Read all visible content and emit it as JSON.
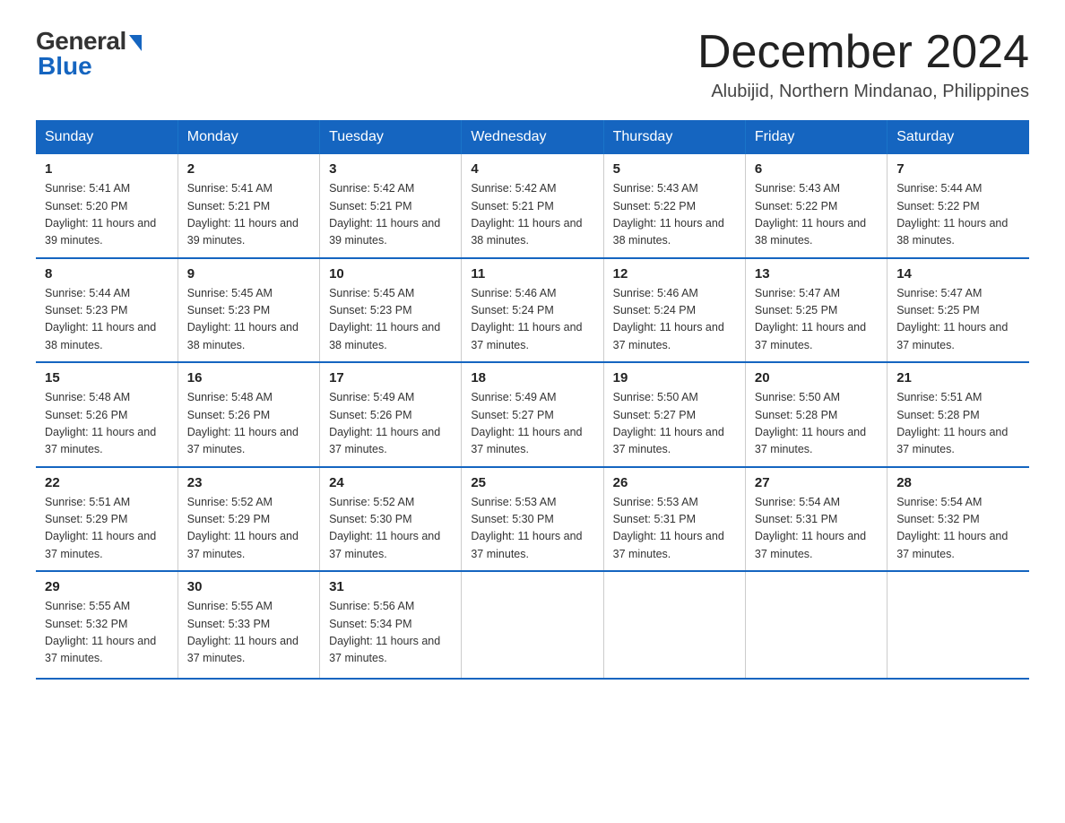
{
  "header": {
    "logo_general": "General",
    "logo_blue": "Blue",
    "month_title": "December 2024",
    "location": "Alubijid, Northern Mindanao, Philippines"
  },
  "weekdays": [
    "Sunday",
    "Monday",
    "Tuesday",
    "Wednesday",
    "Thursday",
    "Friday",
    "Saturday"
  ],
  "weeks": [
    [
      {
        "day": "1",
        "sunrise": "5:41 AM",
        "sunset": "5:20 PM",
        "daylight": "11 hours and 39 minutes."
      },
      {
        "day": "2",
        "sunrise": "5:41 AM",
        "sunset": "5:21 PM",
        "daylight": "11 hours and 39 minutes."
      },
      {
        "day": "3",
        "sunrise": "5:42 AM",
        "sunset": "5:21 PM",
        "daylight": "11 hours and 39 minutes."
      },
      {
        "day": "4",
        "sunrise": "5:42 AM",
        "sunset": "5:21 PM",
        "daylight": "11 hours and 38 minutes."
      },
      {
        "day": "5",
        "sunrise": "5:43 AM",
        "sunset": "5:22 PM",
        "daylight": "11 hours and 38 minutes."
      },
      {
        "day": "6",
        "sunrise": "5:43 AM",
        "sunset": "5:22 PM",
        "daylight": "11 hours and 38 minutes."
      },
      {
        "day": "7",
        "sunrise": "5:44 AM",
        "sunset": "5:22 PM",
        "daylight": "11 hours and 38 minutes."
      }
    ],
    [
      {
        "day": "8",
        "sunrise": "5:44 AM",
        "sunset": "5:23 PM",
        "daylight": "11 hours and 38 minutes."
      },
      {
        "day": "9",
        "sunrise": "5:45 AM",
        "sunset": "5:23 PM",
        "daylight": "11 hours and 38 minutes."
      },
      {
        "day": "10",
        "sunrise": "5:45 AM",
        "sunset": "5:23 PM",
        "daylight": "11 hours and 38 minutes."
      },
      {
        "day": "11",
        "sunrise": "5:46 AM",
        "sunset": "5:24 PM",
        "daylight": "11 hours and 37 minutes."
      },
      {
        "day": "12",
        "sunrise": "5:46 AM",
        "sunset": "5:24 PM",
        "daylight": "11 hours and 37 minutes."
      },
      {
        "day": "13",
        "sunrise": "5:47 AM",
        "sunset": "5:25 PM",
        "daylight": "11 hours and 37 minutes."
      },
      {
        "day": "14",
        "sunrise": "5:47 AM",
        "sunset": "5:25 PM",
        "daylight": "11 hours and 37 minutes."
      }
    ],
    [
      {
        "day": "15",
        "sunrise": "5:48 AM",
        "sunset": "5:26 PM",
        "daylight": "11 hours and 37 minutes."
      },
      {
        "day": "16",
        "sunrise": "5:48 AM",
        "sunset": "5:26 PM",
        "daylight": "11 hours and 37 minutes."
      },
      {
        "day": "17",
        "sunrise": "5:49 AM",
        "sunset": "5:26 PM",
        "daylight": "11 hours and 37 minutes."
      },
      {
        "day": "18",
        "sunrise": "5:49 AM",
        "sunset": "5:27 PM",
        "daylight": "11 hours and 37 minutes."
      },
      {
        "day": "19",
        "sunrise": "5:50 AM",
        "sunset": "5:27 PM",
        "daylight": "11 hours and 37 minutes."
      },
      {
        "day": "20",
        "sunrise": "5:50 AM",
        "sunset": "5:28 PM",
        "daylight": "11 hours and 37 minutes."
      },
      {
        "day": "21",
        "sunrise": "5:51 AM",
        "sunset": "5:28 PM",
        "daylight": "11 hours and 37 minutes."
      }
    ],
    [
      {
        "day": "22",
        "sunrise": "5:51 AM",
        "sunset": "5:29 PM",
        "daylight": "11 hours and 37 minutes."
      },
      {
        "day": "23",
        "sunrise": "5:52 AM",
        "sunset": "5:29 PM",
        "daylight": "11 hours and 37 minutes."
      },
      {
        "day": "24",
        "sunrise": "5:52 AM",
        "sunset": "5:30 PM",
        "daylight": "11 hours and 37 minutes."
      },
      {
        "day": "25",
        "sunrise": "5:53 AM",
        "sunset": "5:30 PM",
        "daylight": "11 hours and 37 minutes."
      },
      {
        "day": "26",
        "sunrise": "5:53 AM",
        "sunset": "5:31 PM",
        "daylight": "11 hours and 37 minutes."
      },
      {
        "day": "27",
        "sunrise": "5:54 AM",
        "sunset": "5:31 PM",
        "daylight": "11 hours and 37 minutes."
      },
      {
        "day": "28",
        "sunrise": "5:54 AM",
        "sunset": "5:32 PM",
        "daylight": "11 hours and 37 minutes."
      }
    ],
    [
      {
        "day": "29",
        "sunrise": "5:55 AM",
        "sunset": "5:32 PM",
        "daylight": "11 hours and 37 minutes."
      },
      {
        "day": "30",
        "sunrise": "5:55 AM",
        "sunset": "5:33 PM",
        "daylight": "11 hours and 37 minutes."
      },
      {
        "day": "31",
        "sunrise": "5:56 AM",
        "sunset": "5:34 PM",
        "daylight": "11 hours and 37 minutes."
      },
      null,
      null,
      null,
      null
    ]
  ]
}
